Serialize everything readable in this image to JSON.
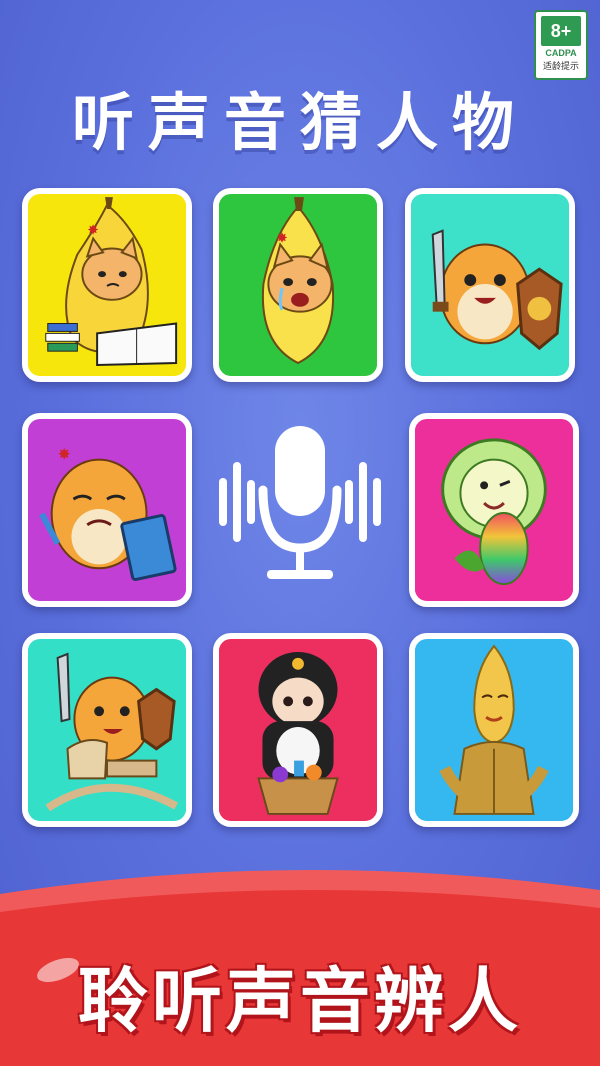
{
  "badge": {
    "rating": "8+",
    "org": "CADPA",
    "tip": "适龄提示"
  },
  "title": "听声音猜人物",
  "slogan": "聆听声音辨人",
  "colors": {
    "background": "#5a6fdc",
    "banner": "#ef3f3f",
    "card_backgrounds": [
      "#f7e60b",
      "#2fc63f",
      "#3de0c8",
      "#c23fd6",
      "#ec2f9a",
      "#34dfc8",
      "#ec2f5f",
      "#35b8ef"
    ]
  },
  "cards": [
    {
      "name": "banana-cat-studying",
      "icon": "banana-cat-icon"
    },
    {
      "name": "banana-cat-crying",
      "icon": "banana-cat-icon"
    },
    {
      "name": "hamster-knight",
      "icon": "hamster-icon"
    },
    {
      "name": "hamster-with-book",
      "icon": "hamster-icon"
    },
    {
      "name": "cabbage-baby",
      "icon": "cabbage-icon"
    },
    {
      "name": "hamster-rocking-horse",
      "icon": "hamster-icon"
    },
    {
      "name": "penguin-girl",
      "icon": "girl-icon"
    },
    {
      "name": "golden-banana-man",
      "icon": "banana-man-icon"
    }
  ],
  "center": {
    "icon": "microphone-icon"
  }
}
